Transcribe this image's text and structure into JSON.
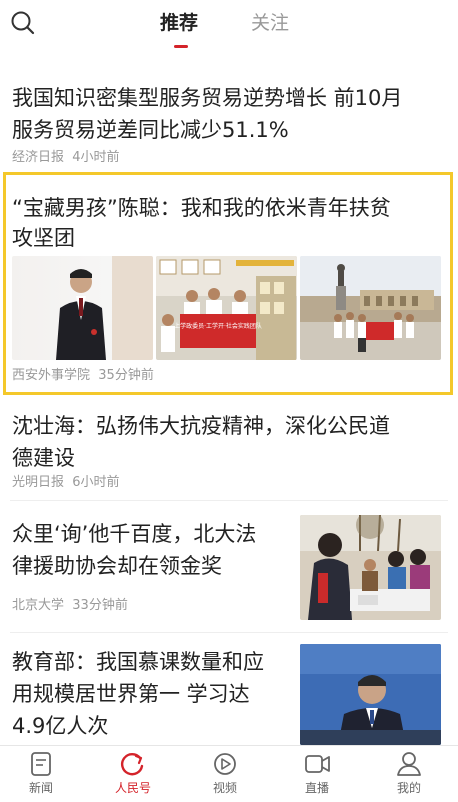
{
  "tabs": {
    "recommend": "推荐",
    "follow": "关注"
  },
  "feed": [
    {
      "title_line1": "我国知识密集型服务贸易逆势增长 前10月",
      "title_line2": "服务贸易逆差同比减少51.1%",
      "source": "经济日报",
      "time": "4小时前"
    },
    {
      "title_line1": "“宝藏男孩”陈聪：我和我的依米青年扶贫",
      "title_line2": "攻坚团",
      "source": "西安外事学院",
      "time": "35分钟前",
      "banner_text": "上学政委员·工学开·社会实践团队"
    },
    {
      "title_line1": "沈壮海：弘扬伟大抗疫精神，深化公民道",
      "title_line2": "德建设",
      "source": "光明日报",
      "time": "6小时前"
    },
    {
      "title_line1": "众里‘询’他千百度，北大法",
      "title_line2": "律援助协会却在领金奖",
      "source": "北京大学",
      "time": "33分钟前"
    },
    {
      "title_line1": "教育部：我国慕课数量和应",
      "title_line2": "用规模居世界第一 学习达",
      "title_line3": "4.9亿人次"
    }
  ],
  "nav": [
    {
      "label": "新闻",
      "icon": "news-icon"
    },
    {
      "label": "人民号",
      "icon": "refresh-icon"
    },
    {
      "label": "视频",
      "icon": "video-icon"
    },
    {
      "label": "直播",
      "icon": "live-icon"
    },
    {
      "label": "我的",
      "icon": "profile-icon"
    }
  ],
  "colors": {
    "accent": "#d4232a",
    "highlight": "#f4c82a"
  }
}
